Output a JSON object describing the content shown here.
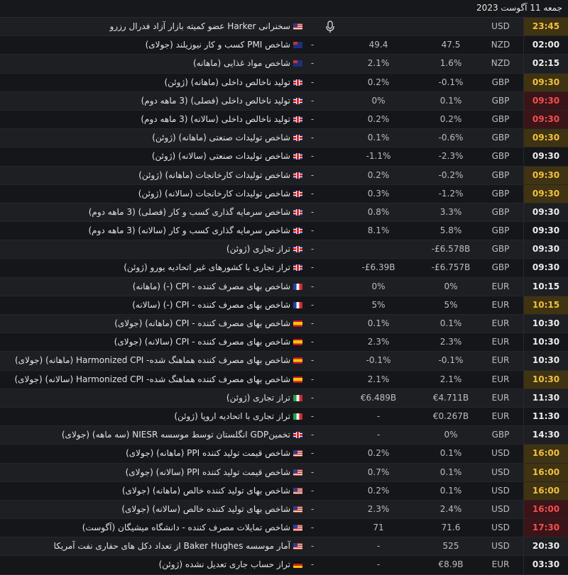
{
  "date": "جمعه 11 آگوست 2023",
  "rows": [
    {
      "time": "23:45",
      "hl": "y",
      "cur": "USD",
      "act": "",
      "fc": "",
      "prev": "",
      "flag": "us",
      "mic": true,
      "title": "سخنرانی Harker عضو کمیته بازار آزاد فدرال رزرو"
    },
    {
      "time": "02:00",
      "hl": "",
      "cur": "NZD",
      "act": "47.5",
      "fc": "49.4",
      "prev": "-",
      "flag": "nz",
      "mic": false,
      "title": "شاخص PMI کسب و کار نیوزیلند (جولای)"
    },
    {
      "time": "02:15",
      "hl": "",
      "cur": "NZD",
      "act": "1.6%",
      "fc": "2.1%",
      "prev": "-",
      "flag": "nz",
      "mic": false,
      "title": "شاخص مواد غذایی (ماهانه)"
    },
    {
      "time": "09:30",
      "hl": "y",
      "cur": "GBP",
      "act": "-0.1%",
      "fc": "0.2%",
      "prev": "-",
      "flag": "gb",
      "mic": false,
      "title": "تولید ناخالص داخلی (ماهانه) (ژوئن)"
    },
    {
      "time": "09:30",
      "hl": "r",
      "cur": "GBP",
      "act": "0.1%",
      "fc": "0%",
      "prev": "-",
      "flag": "gb",
      "mic": false,
      "title": "تولید ناخالص داخلی (فصلی) (3 ماهه دوم)"
    },
    {
      "time": "09:30",
      "hl": "r",
      "cur": "GBP",
      "act": "0.2%",
      "fc": "0.2%",
      "prev": "-",
      "flag": "gb",
      "mic": false,
      "title": "تولید ناخالص داخلی (سالانه) (3 ماهه دوم)"
    },
    {
      "time": "09:30",
      "hl": "y",
      "cur": "GBP",
      "act": "-0.6%",
      "fc": "0.1%",
      "prev": "-",
      "flag": "gb",
      "mic": false,
      "title": "شاخص تولیدات صنعتی (ماهانه) (ژوئن)"
    },
    {
      "time": "09:30",
      "hl": "",
      "cur": "GBP",
      "act": "-2.3%",
      "fc": "-1.1%",
      "prev": "-",
      "flag": "gb",
      "mic": false,
      "title": "شاخص تولیدات صنعتی (سالانه) (ژوئن)"
    },
    {
      "time": "09:30",
      "hl": "y",
      "cur": "GBP",
      "act": "-0.2%",
      "fc": "0.2%",
      "prev": "-",
      "flag": "gb",
      "mic": false,
      "title": "شاخص تولیدات کارخانجات (ماهانه) (ژوئن)"
    },
    {
      "time": "09:30",
      "hl": "y",
      "cur": "GBP",
      "act": "-1.2%",
      "fc": "0.3%",
      "prev": "-",
      "flag": "gb",
      "mic": false,
      "title": "شاخص تولیدات کارخانجات (سالانه) (ژوئن)"
    },
    {
      "time": "09:30",
      "hl": "",
      "cur": "GBP",
      "act": "3.3%",
      "fc": "0.8%",
      "prev": "-",
      "flag": "gb",
      "mic": false,
      "title": "شاخص سرمایه گذاری کسب و کار (فصلی) (3 ماهه دوم)"
    },
    {
      "time": "09:30",
      "hl": "",
      "cur": "GBP",
      "act": "5.8%",
      "fc": "8.1%",
      "prev": "-",
      "flag": "gb",
      "mic": false,
      "title": "شاخص سرمایه گذاری کسب و کار (سالانه) (3 ماهه دوم)"
    },
    {
      "time": "09:30",
      "hl": "",
      "cur": "GBP",
      "act": "-£6.578B",
      "fc": "",
      "prev": "-",
      "flag": "gb",
      "mic": false,
      "title": "تراز تجاری (ژوئن)"
    },
    {
      "time": "09:30",
      "hl": "",
      "cur": "GBP",
      "act": "-£6.757B",
      "fc": "-£6.39B",
      "prev": "-",
      "flag": "gb",
      "mic": false,
      "title": "تراز تجاری با کشورهای غیر اتحادیه یورو (ژوئن)"
    },
    {
      "time": "10:15",
      "hl": "",
      "cur": "EUR",
      "act": "0%",
      "fc": "0%",
      "prev": "-",
      "flag": "fr",
      "mic": false,
      "title": "شاخص بهای مصرف کننده - CPI (-) (ماهانه)"
    },
    {
      "time": "10:15",
      "hl": "y",
      "cur": "EUR",
      "act": "5%",
      "fc": "5%",
      "prev": "-",
      "flag": "fr",
      "mic": false,
      "title": "شاخص بهای مصرف کننده - CPI (-) (سالانه)"
    },
    {
      "time": "10:30",
      "hl": "",
      "cur": "EUR",
      "act": "0.1%",
      "fc": "0.1%",
      "prev": "-",
      "flag": "es",
      "mic": false,
      "title": "شاخص بهای مصرف کننده - CPI (ماهانه) (جولای)"
    },
    {
      "time": "10:30",
      "hl": "",
      "cur": "EUR",
      "act": "2.3%",
      "fc": "2.3%",
      "prev": "-",
      "flag": "es",
      "mic": false,
      "title": "شاخص بهای مصرف کننده - CPI (سالانه) (جولای)"
    },
    {
      "time": "10:30",
      "hl": "",
      "cur": "EUR",
      "act": "-0.1%",
      "fc": "-0.1%",
      "prev": "-",
      "flag": "es",
      "mic": false,
      "title": "شاخص بهای مصرف کننده هماهنگ شده- Harmonized CPI (ماهانه) (جولای)"
    },
    {
      "time": "10:30",
      "hl": "y",
      "cur": "EUR",
      "act": "2.1%",
      "fc": "2.1%",
      "prev": "-",
      "flag": "es",
      "mic": false,
      "title": "شاخص بهای مصرف کننده هماهنگ شده- Harmonized CPI (سالانه) (جولای)"
    },
    {
      "time": "11:30",
      "hl": "",
      "cur": "EUR",
      "act": "€4.711B",
      "fc": "€6.489B",
      "prev": "-",
      "flag": "it",
      "mic": false,
      "title": "تراز تجاری (ژوئن)"
    },
    {
      "time": "11:30",
      "hl": "",
      "cur": "EUR",
      "act": "€0.267B",
      "fc": "-",
      "prev": "-",
      "flag": "it",
      "mic": false,
      "title": "تراز تجاری با اتحادیه اروپا (ژوئن)"
    },
    {
      "time": "14:30",
      "hl": "",
      "cur": "GBP",
      "act": "0%",
      "fc": "-",
      "prev": "-",
      "flag": "gb",
      "mic": false,
      "title": "تخمینGDP انگلستان توسط موسسه NIESR (سه ماهه) (جولای)"
    },
    {
      "time": "16:00",
      "hl": "y",
      "cur": "USD",
      "act": "0.1%",
      "fc": "0.2%",
      "prev": "-",
      "flag": "us",
      "mic": false,
      "title": "شاخص قیمت تولید کننده PPI (ماهانه) (جولای)"
    },
    {
      "time": "16:00",
      "hl": "y",
      "cur": "USD",
      "act": "0.1%",
      "fc": "0.7%",
      "prev": "-",
      "flag": "us",
      "mic": false,
      "title": "شاخص قیمت تولید کننده PPI (سالانه) (جولای)"
    },
    {
      "time": "16:00",
      "hl": "y",
      "cur": "USD",
      "act": "0.1%",
      "fc": "0.2%",
      "prev": "-",
      "flag": "us",
      "mic": false,
      "title": "شاخص بهای تولید کننده خالص (ماهانه) (جولای)"
    },
    {
      "time": "16:00",
      "hl": "r",
      "cur": "USD",
      "act": "2.4%",
      "fc": "2.3%",
      "prev": "-",
      "flag": "us",
      "mic": false,
      "title": "شاخص بهای تولید کننده خالص (سالانه) (جولای)"
    },
    {
      "time": "17:30",
      "hl": "r",
      "cur": "USD",
      "act": "71.6",
      "fc": "71",
      "prev": "-",
      "flag": "us",
      "mic": false,
      "title": "شاخص تمایلات مصرف کننده - دانشگاه میشیگان (آگوست)"
    },
    {
      "time": "20:30",
      "hl": "",
      "cur": "USD",
      "act": "525",
      "fc": "-",
      "prev": "-",
      "flag": "us",
      "mic": false,
      "title": "آمار موسسه Baker Hughes از تعداد دکل های حفاری نفت آمریکا"
    },
    {
      "time": "03:30",
      "hl": "",
      "cur": "EUR",
      "act": "€8.9B",
      "fc": "-",
      "prev": "-",
      "flag": "de",
      "mic": false,
      "title": "تراز حساب جاری تعدیل نشده (ژوئن)"
    }
  ]
}
